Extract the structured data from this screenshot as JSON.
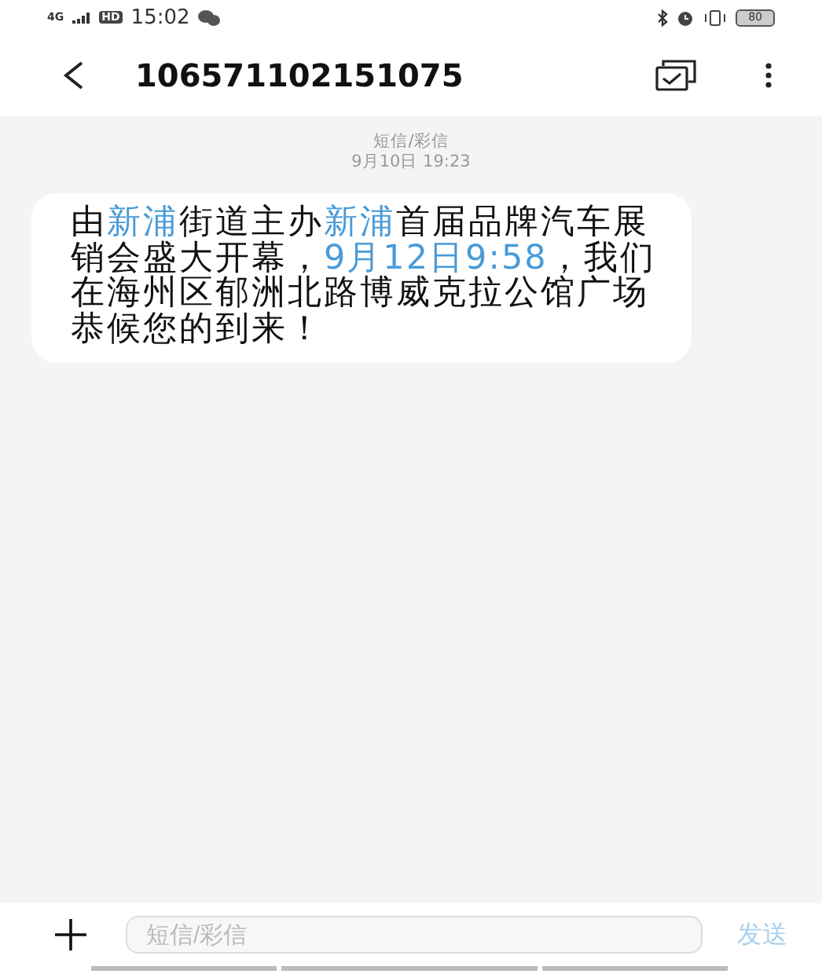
{
  "status_bar": {
    "network": "4G",
    "hd": "HD",
    "time": "15:02",
    "battery": "80"
  },
  "header": {
    "title": "106571102151075"
  },
  "conversation": {
    "channel": "短信/彩信",
    "date": "9月10日 19:23"
  },
  "message": {
    "segments": [
      {
        "text": "由",
        "link": false
      },
      {
        "text": "新浦",
        "link": true
      },
      {
        "text": "街道主办",
        "link": false
      },
      {
        "text": "新浦",
        "link": true
      },
      {
        "text": "首届品牌汽车展销会盛大开幕，",
        "link": false
      },
      {
        "text": "9月12日9:58",
        "link": true
      },
      {
        "text": "，我们在海州区郁洲北路博威克拉公馆广场恭候您的到来！",
        "link": false
      }
    ]
  },
  "composer": {
    "placeholder": "短信/彩信",
    "send": "发送",
    "send_disabled": true
  }
}
